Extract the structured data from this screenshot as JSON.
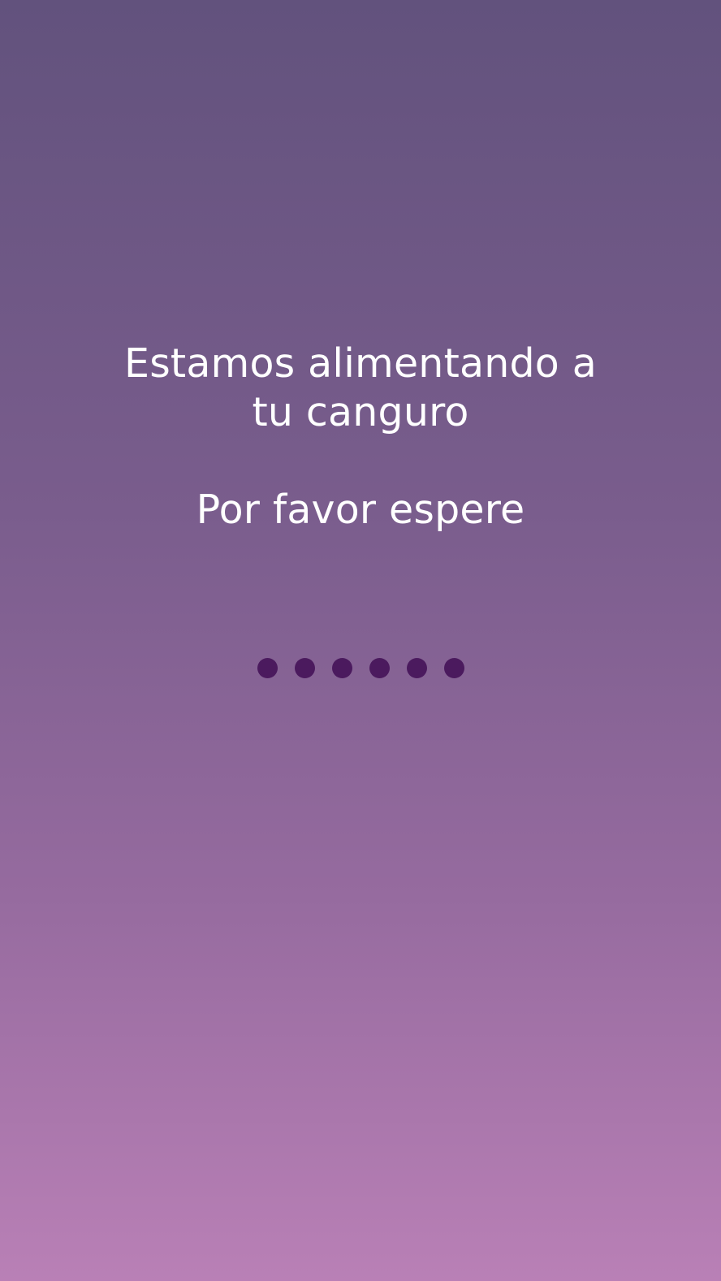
{
  "loading_screen": {
    "message_line_1": "Estamos alimentando a",
    "message_line_2": "tu canguro",
    "wait_text": "Por favor espere",
    "dots_count": 6,
    "dot_color": "#4b1a5e"
  },
  "colors": {
    "background_top": "#62527d",
    "background_bottom": "#b980b6",
    "text": "#ffffff"
  }
}
